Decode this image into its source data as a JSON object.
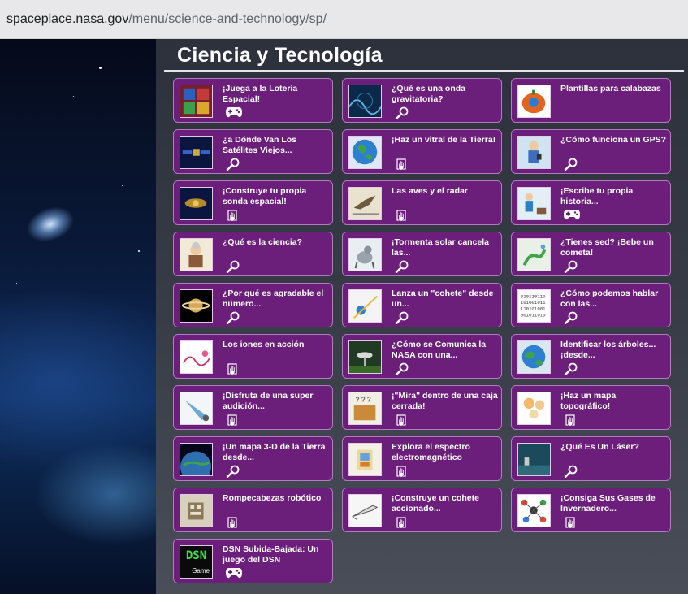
{
  "browser": {
    "url_host": "spaceplace.nasa.gov",
    "url_path": "/menu/science-and-technology/sp/"
  },
  "page": {
    "title": "Ciencia y Tecnología"
  },
  "colors": {
    "card_bg": "#6b1f7a",
    "card_border": "#b47ac1",
    "text": "#ffffff"
  },
  "cards": [
    {
      "label": "¡Juega a la Lotería Espacial!",
      "kind": "game",
      "icon": "gamepad-icon",
      "thumb": "lottery"
    },
    {
      "label": "¿Qué es una onda gravitatoria?",
      "kind": "read",
      "icon": "magnifier-icon",
      "thumb": "wave"
    },
    {
      "label": "Plantillas para calabazas",
      "kind": "activity",
      "icon": "",
      "thumb": "pumpkin"
    },
    {
      "label": "¿a Dónde Van Los Satélites Viejos...",
      "kind": "read",
      "icon": "magnifier-icon",
      "thumb": "satellite"
    },
    {
      "label": "¡Haz un vitral de la Tierra!",
      "kind": "activity",
      "icon": "activity-hand-icon",
      "thumb": "earth"
    },
    {
      "label": "¿Cómo funciona un GPS?",
      "kind": "read",
      "icon": "magnifier-icon",
      "thumb": "gps"
    },
    {
      "label": "¡Construye tu propia sonda espacial!",
      "kind": "activity",
      "icon": "activity-hand-icon",
      "thumb": "probe"
    },
    {
      "label": "Las aves y el radar",
      "kind": "activity",
      "icon": "activity-hand-icon",
      "thumb": "bird"
    },
    {
      "label": "¡Escribe tu propia historia...",
      "kind": "game",
      "icon": "gamepad-icon",
      "thumb": "story"
    },
    {
      "label": "¿Qué es la ciencia?",
      "kind": "read",
      "icon": "magnifier-icon",
      "thumb": "scientist"
    },
    {
      "label": "¡Tormenta solar cancela las...",
      "kind": "read",
      "icon": "magnifier-icon",
      "thumb": "storm"
    },
    {
      "label": "¿Tienes sed? ¡Bebe un cometa!",
      "kind": "read",
      "icon": "magnifier-icon",
      "thumb": "comet"
    },
    {
      "label": "¿Por qué es agradable el número...",
      "kind": "read",
      "icon": "magnifier-icon",
      "thumb": "saturn"
    },
    {
      "label": "Lanza un \"cohete\" desde un...",
      "kind": "read",
      "icon": "magnifier-icon",
      "thumb": "rocket-launch"
    },
    {
      "label": "¿Cómo podemos hablar con las...",
      "kind": "read",
      "icon": "magnifier-icon",
      "thumb": "binary"
    },
    {
      "label": "Los iones en acción",
      "kind": "activity",
      "icon": "activity-hand-icon",
      "thumb": "ions"
    },
    {
      "label": "¿Cómo se Comunica la NASA con una...",
      "kind": "read",
      "icon": "magnifier-icon",
      "thumb": "antenna"
    },
    {
      "label": "Identificar los árboles... ¡desde...",
      "kind": "read",
      "icon": "magnifier-icon",
      "thumb": "globe"
    },
    {
      "label": "¡Disfruta de una super audición...",
      "kind": "activity",
      "icon": "activity-hand-icon",
      "thumb": "horn"
    },
    {
      "label": "¡\"Mira\" dentro de una caja cerrada!",
      "kind": "activity",
      "icon": "activity-hand-icon",
      "thumb": "box"
    },
    {
      "label": "¡Haz un mapa topográfico!",
      "kind": "activity",
      "icon": "activity-hand-icon",
      "thumb": "topo"
    },
    {
      "label": "¡Un mapa 3-D de la Tierra desde...",
      "kind": "read",
      "icon": "magnifier-icon",
      "thumb": "earth3d"
    },
    {
      "label": "Explora el espectro electromagnético",
      "kind": "activity",
      "icon": "activity-hand-icon",
      "thumb": "spectrum"
    },
    {
      "label": "¿Qué Es Un Láser?",
      "kind": "read",
      "icon": "magnifier-icon",
      "thumb": "laser"
    },
    {
      "label": "Rompecabezas robótico",
      "kind": "activity",
      "icon": "activity-hand-icon",
      "thumb": "robot"
    },
    {
      "label": "¡Construye un cohete accionado...",
      "kind": "activity",
      "icon": "activity-hand-icon",
      "thumb": "rocket"
    },
    {
      "label": "¡Consiga Sus Gases de Invernadero...",
      "kind": "activity",
      "icon": "activity-hand-icon",
      "thumb": "molecule"
    },
    {
      "label": "DSN Subida-Bajada: Un juego del DSN",
      "kind": "game",
      "icon": "gamepad-icon",
      "thumb": "dsn",
      "thumb_text": "DSN",
      "thumb_sub": "Game"
    }
  ]
}
